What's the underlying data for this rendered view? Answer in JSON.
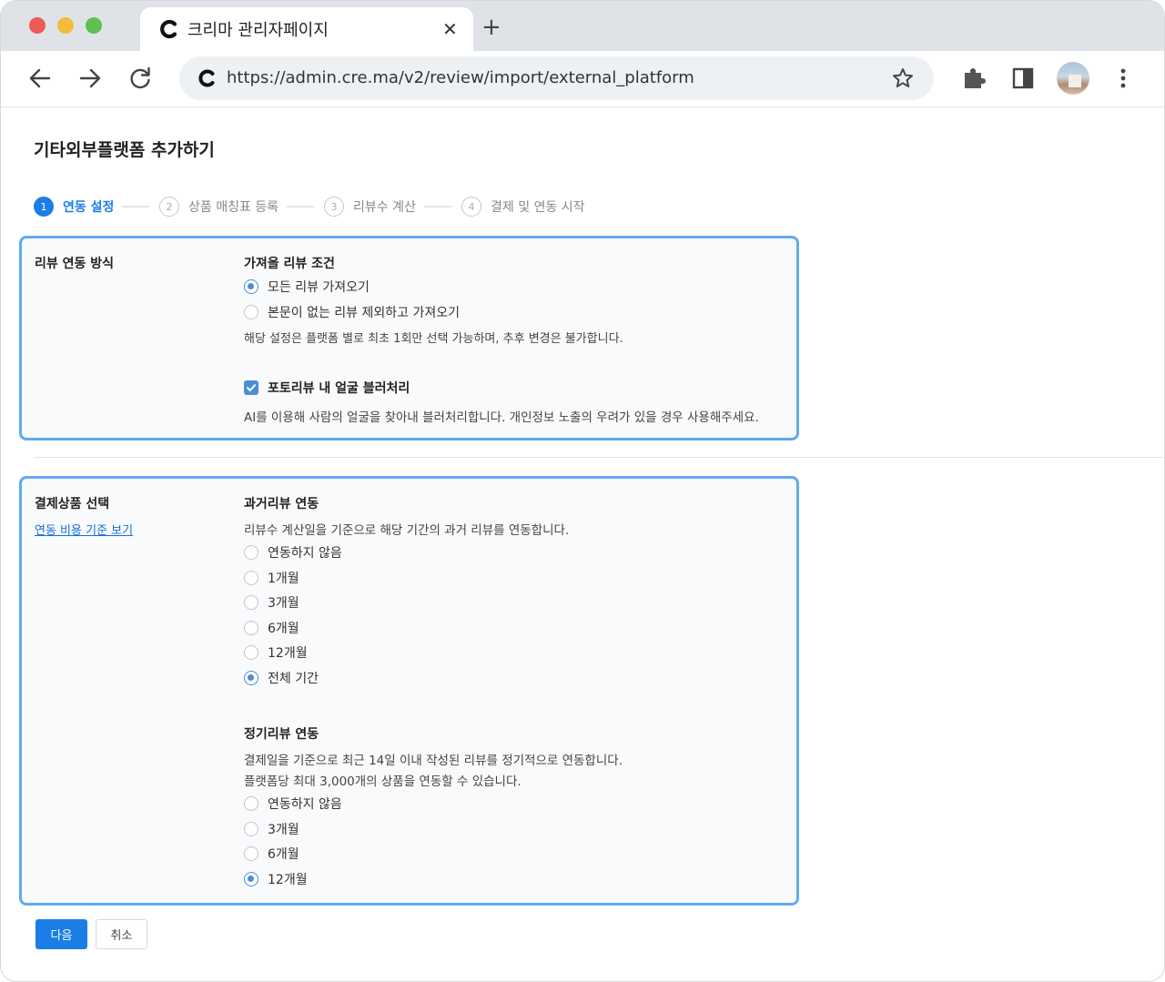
{
  "browser": {
    "tab_title": "크리마 관리자페이지",
    "url": "https://admin.cre.ma/v2/review/import/external_platform"
  },
  "page": {
    "title": "기타외부플랫폼 추가하기"
  },
  "stepper": {
    "steps": [
      {
        "num": "1",
        "label": "연동 설정",
        "active": true
      },
      {
        "num": "2",
        "label": "상품 매칭표 등록",
        "active": false
      },
      {
        "num": "3",
        "label": "리뷰수 계산",
        "active": false
      },
      {
        "num": "4",
        "label": "결제 및 연동 시작",
        "active": false
      }
    ]
  },
  "card1": {
    "label": "리뷰 연동 방식",
    "condition_title": "가져올 리뷰 조건",
    "options": [
      {
        "label": "모든 리뷰 가져오기",
        "selected": true
      },
      {
        "label": "본문이 없는 리뷰 제외하고 가져오기",
        "selected": false
      }
    ],
    "condition_note": "해당 설정은 플랫폼 별로 최초 1회만 선택 가능하며, 추후 변경은 불가합니다.",
    "blur_label": "포토리뷰 내 얼굴 블러처리",
    "blur_checked": true,
    "blur_desc": "AI를 이용해 사람의 얼굴을 찾아내 블러처리합니다. 개인정보 노출의 우려가 있을 경우 사용해주세요."
  },
  "card2": {
    "label": "결제상품 선택",
    "link": "연동 비용 기준 보기",
    "past": {
      "title": "과거리뷰 연동",
      "desc": "리뷰수 계산일을 기준으로 해당 기간의 과거 리뷰를 연동합니다.",
      "options": [
        {
          "label": "연동하지 않음",
          "selected": false
        },
        {
          "label": "1개월",
          "selected": false
        },
        {
          "label": "3개월",
          "selected": false
        },
        {
          "label": "6개월",
          "selected": false
        },
        {
          "label": "12개월",
          "selected": false
        },
        {
          "label": "전체 기간",
          "selected": true
        }
      ]
    },
    "regular": {
      "title": "정기리뷰 연동",
      "desc1": "결제일을 기준으로 최근 14일 이내 작성된 리뷰를 정기적으로 연동합니다.",
      "desc2": "플랫폼당 최대 3,000개의 상품을 연동할 수 있습니다.",
      "options": [
        {
          "label": "연동하지 않음",
          "selected": false
        },
        {
          "label": "3개월",
          "selected": false
        },
        {
          "label": "6개월",
          "selected": false
        },
        {
          "label": "12개월",
          "selected": true
        }
      ]
    }
  },
  "buttons": {
    "next": "다음",
    "cancel": "취소"
  },
  "colors": {
    "accent": "#1a7ee6",
    "card_border": "#62aaf0"
  }
}
